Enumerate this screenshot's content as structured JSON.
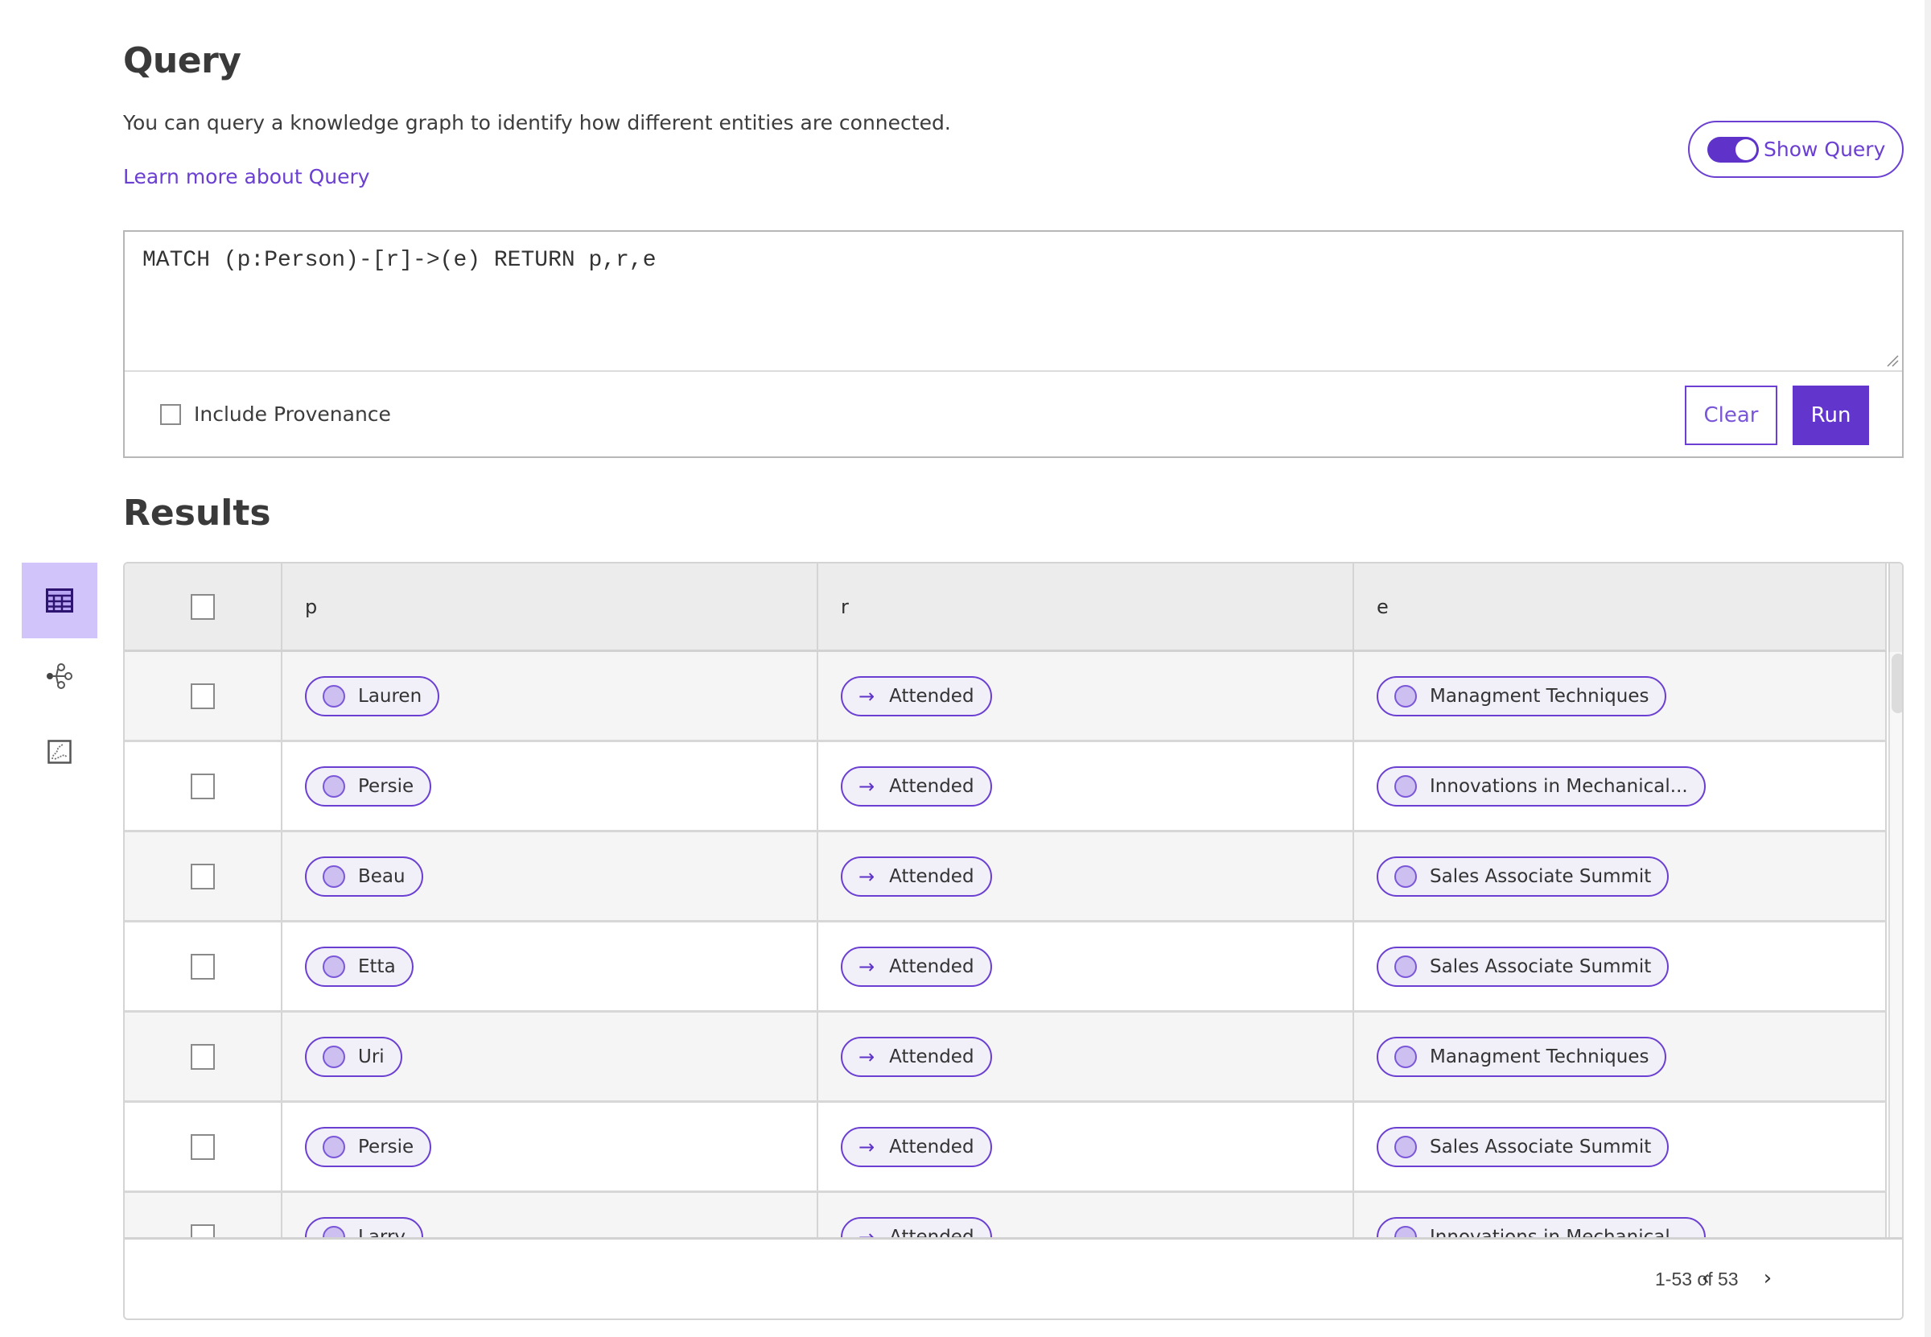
{
  "header": {
    "title": "Query",
    "description": "You can query a knowledge graph to identify how different entities are connected.",
    "learn_more_link": "Learn more about Query",
    "show_query_toggle": {
      "label": "Show Query",
      "checked": true
    }
  },
  "query_editor": {
    "value": "MATCH (p:Person)-[r]->(e) RETURN p,r,e",
    "include_provenance": {
      "label": "Include Provenance",
      "checked": false
    },
    "clear_label": "Clear",
    "run_label": "Run"
  },
  "results": {
    "title": "Results",
    "view_switcher": [
      {
        "name": "table-view",
        "icon": "table-icon",
        "active": true
      },
      {
        "name": "graph-view",
        "icon": "graph-nodes-icon",
        "active": false
      },
      {
        "name": "chart-view",
        "icon": "chart-icon",
        "active": false
      }
    ],
    "columns": [
      "p",
      "r",
      "e"
    ],
    "rows": [
      {
        "p": "Lauren",
        "r": "Attended",
        "e": "Managment Techniques"
      },
      {
        "p": "Persie",
        "r": "Attended",
        "e": "Innovations in Mechanical..."
      },
      {
        "p": "Beau",
        "r": "Attended",
        "e": "Sales Associate Summit"
      },
      {
        "p": "Etta",
        "r": "Attended",
        "e": "Sales Associate Summit"
      },
      {
        "p": "Uri",
        "r": "Attended",
        "e": "Managment Techniques"
      },
      {
        "p": "Persie",
        "r": "Attended",
        "e": "Sales Associate Summit"
      },
      {
        "p": "Larry",
        "r": "Attended",
        "e": "Innovations in Mechanical..."
      }
    ],
    "pagination": {
      "range_text": "1-53 of 53",
      "prev_icon": "chevron-left-icon",
      "next_icon": "chevron-right-icon"
    }
  },
  "colors": {
    "accent": "#6236cd",
    "accent_light": "#d1c4fb",
    "chip_fill": "#f1eff8",
    "row_stripe": "#f5f5f5",
    "header_bg": "#ececec"
  }
}
